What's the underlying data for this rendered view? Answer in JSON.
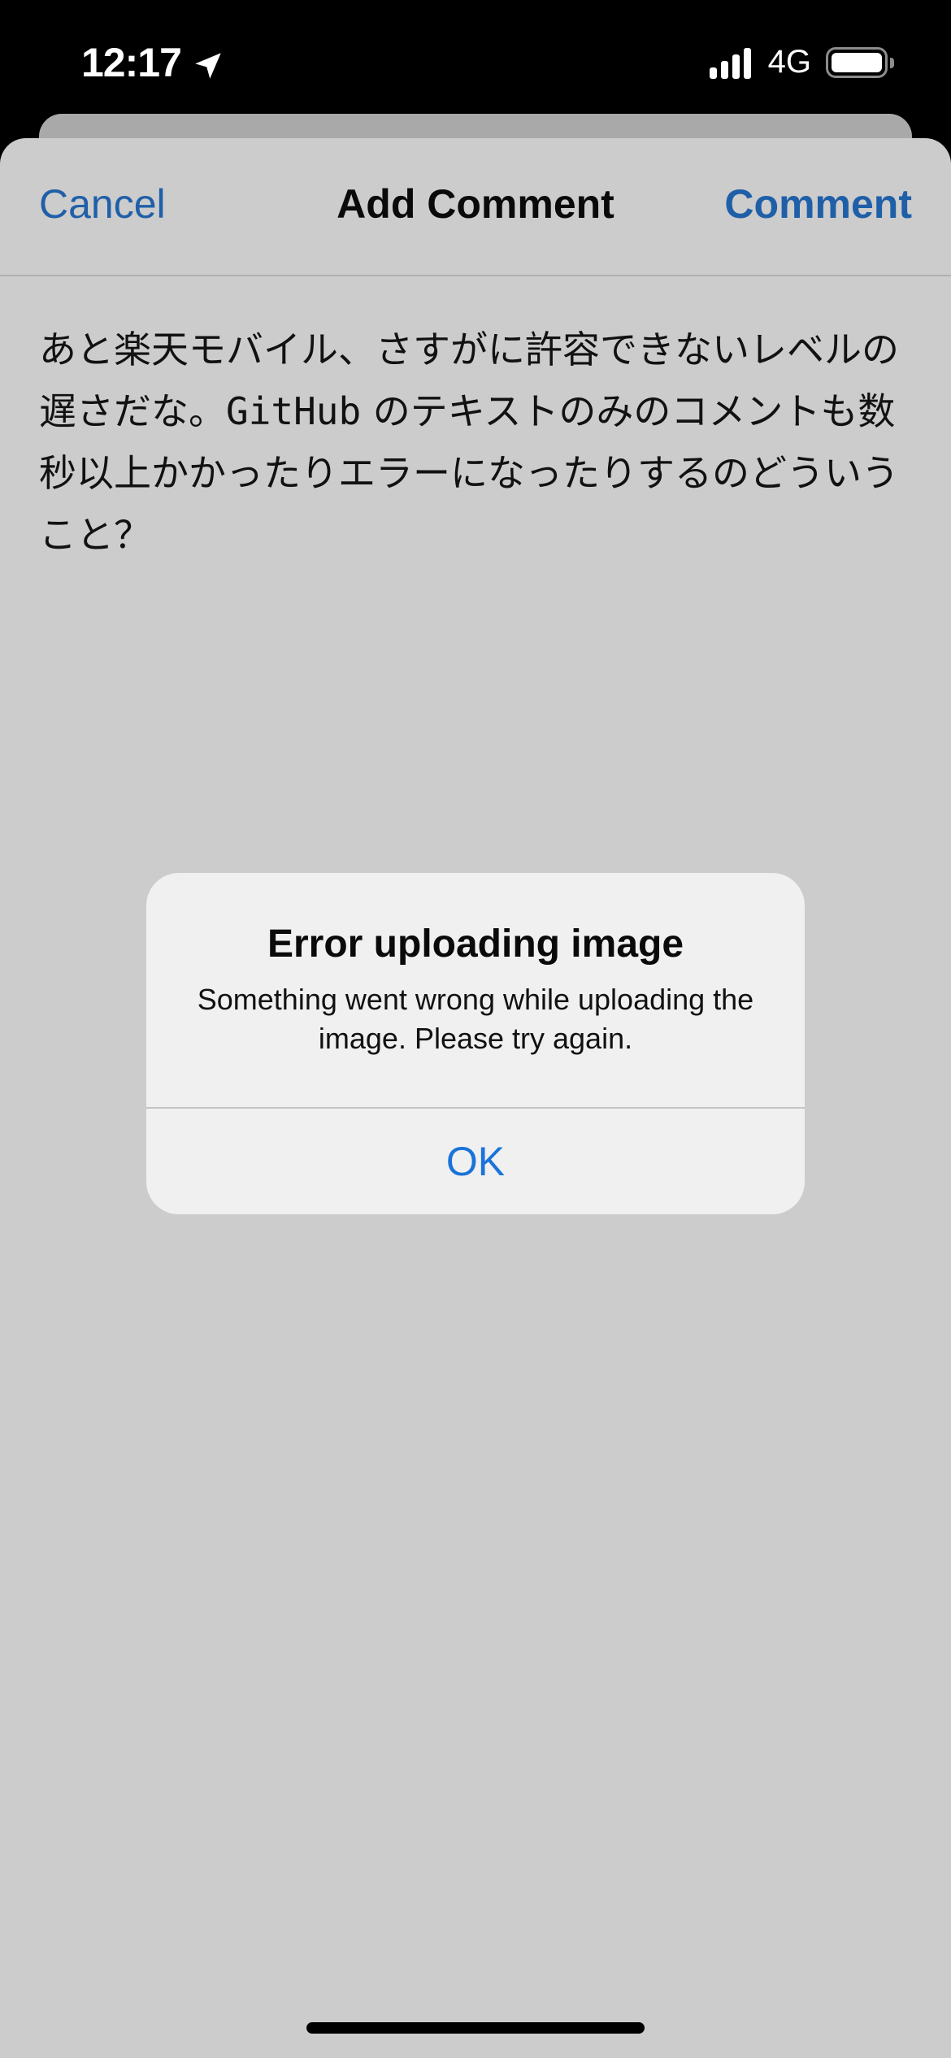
{
  "status_bar": {
    "time": "12:17",
    "network": "4G",
    "icons": [
      "location-arrow-icon",
      "cellular-signal-icon",
      "battery-icon"
    ]
  },
  "nav": {
    "cancel_label": "Cancel",
    "title": "Add Comment",
    "comment_label": "Comment"
  },
  "comment": {
    "text_before": "あと楽天モバイル、さすがに許容できないレベルの遅さだな。",
    "text_code": "GitHub",
    "text_after": " のテキストのみのコメントも数秒以上かかったりエラーになったりするのどういうこと？"
  },
  "alert": {
    "title": "Error uploading image",
    "message": "Something went wrong while uploading the image. Please try again.",
    "ok_label": "OK"
  },
  "colors": {
    "accent": "#1f5fa8",
    "alert_button": "#1a73d9",
    "sheet_background": "#cccccc",
    "alert_background": "#f0f0f0"
  }
}
